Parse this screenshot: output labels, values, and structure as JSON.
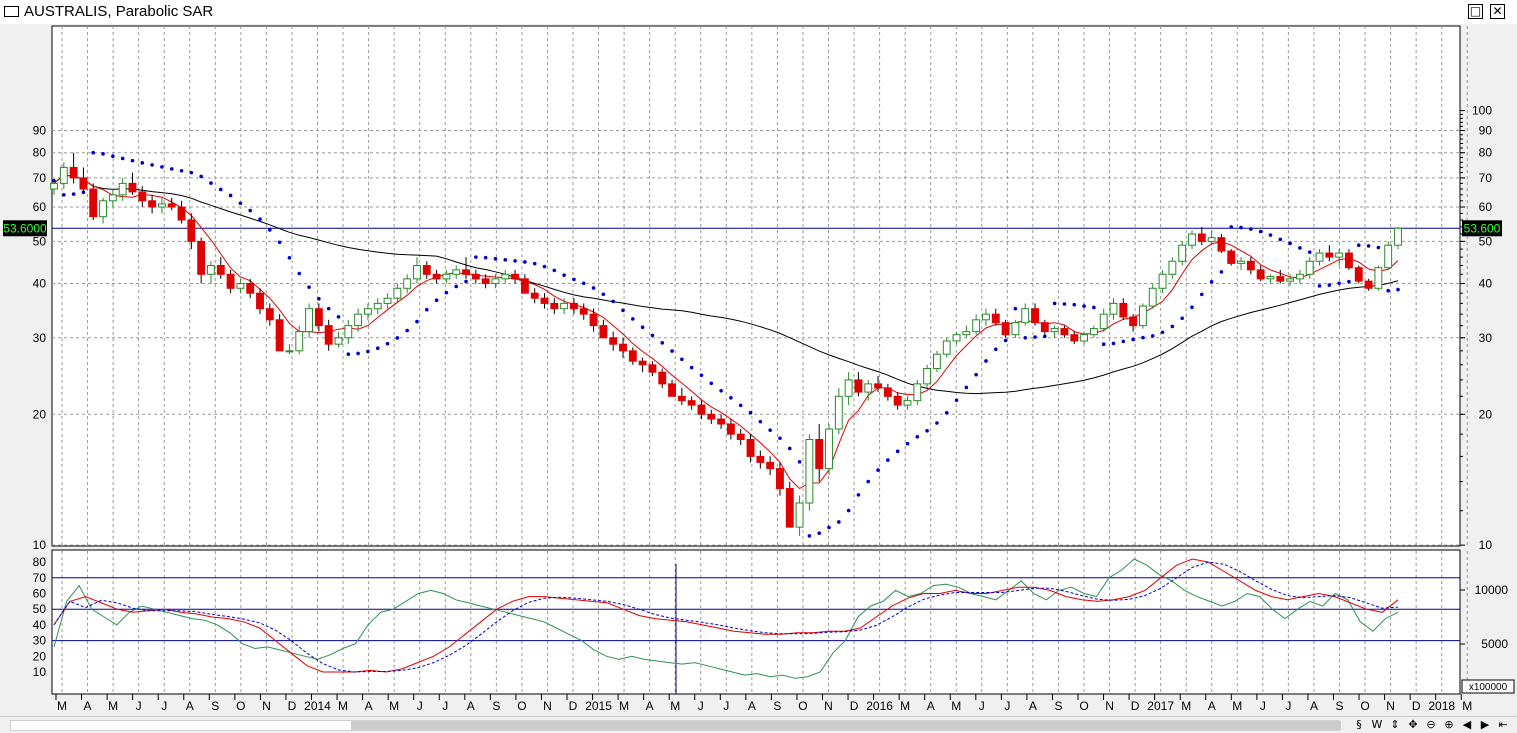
{
  "window": {
    "title": "AUSTRALIS, Parabolic SAR"
  },
  "colors": {
    "up": "#ffffff",
    "up_border": "#2a8a2a",
    "down": "#e00000",
    "sar": "#0000cc",
    "ma_fast": "#e00000",
    "ma_slow": "#000000",
    "osc": "#2f8f55",
    "level": "#00009a",
    "price_tag": "#000000",
    "price_tag_text": "#33ff33"
  },
  "chart_data": [
    {
      "type": "candlestick",
      "title": "AUSTRALIS, Parabolic SAR",
      "y_scale": "log",
      "left_ticks": [
        "10",
        "20",
        "30",
        "40",
        "50",
        "60",
        "70",
        "80",
        "90"
      ],
      "right_ticks": [
        "10",
        "20",
        "30",
        "40",
        "50",
        "60",
        "70",
        "80",
        "90",
        "100"
      ],
      "last_price": "53.6000",
      "last_price_right": "53.600",
      "x_labels": [
        "M",
        "A",
        "M",
        "J",
        "J",
        "A",
        "S",
        "O",
        "N",
        "D",
        "2014",
        "M",
        "A",
        "M",
        "J",
        "J",
        "A",
        "S",
        "O",
        "N",
        "D",
        "2015",
        "M",
        "A",
        "M",
        "J",
        "J",
        "A",
        "S",
        "O",
        "N",
        "D",
        "2016",
        "M",
        "A",
        "M",
        "J",
        "J",
        "A",
        "S",
        "O",
        "N",
        "D",
        "2017",
        "M",
        "A",
        "M",
        "J",
        "J",
        "A",
        "S",
        "O",
        "N",
        "D",
        "2018",
        "M"
      ],
      "series_ohlc_weekly": [
        [
          66,
          69,
          64,
          68
        ],
        [
          68,
          76,
          66,
          74
        ],
        [
          74,
          80,
          68,
          70
        ],
        [
          70,
          74,
          65,
          66
        ],
        [
          66,
          68,
          56,
          57
        ],
        [
          57,
          63,
          55,
          62
        ],
        [
          62,
          66,
          60,
          64
        ],
        [
          64,
          70,
          62,
          68
        ],
        [
          68,
          72,
          64,
          65
        ],
        [
          65,
          67,
          60,
          62
        ],
        [
          62,
          64,
          58,
          60
        ],
        [
          60,
          63,
          58,
          61
        ],
        [
          61,
          63,
          59,
          60
        ],
        [
          60,
          62,
          55,
          56
        ],
        [
          56,
          58,
          48,
          50
        ],
        [
          50,
          51,
          40,
          42
        ],
        [
          42,
          45,
          40,
          44
        ],
        [
          44,
          46,
          41,
          42
        ],
        [
          42,
          43,
          38,
          39
        ],
        [
          39,
          41,
          38,
          40
        ],
        [
          40,
          41,
          37,
          38
        ],
        [
          38,
          39,
          34,
          35
        ],
        [
          35,
          36,
          32,
          33
        ],
        [
          33,
          34,
          28,
          28
        ],
        [
          28,
          29,
          27.5,
          28
        ],
        [
          28,
          32,
          27.5,
          31
        ],
        [
          31,
          36,
          30,
          35
        ],
        [
          35,
          36,
          31,
          32
        ],
        [
          32,
          33,
          28,
          29
        ],
        [
          29,
          31,
          28.5,
          30
        ],
        [
          30,
          33,
          29,
          32
        ],
        [
          32,
          35,
          31,
          34
        ],
        [
          34,
          36,
          33,
          35
        ],
        [
          35,
          37,
          34,
          36
        ],
        [
          36,
          38,
          35,
          37
        ],
        [
          37,
          40,
          36,
          39
        ],
        [
          39,
          42,
          38,
          41
        ],
        [
          41,
          46,
          40,
          44
        ],
        [
          44,
          45,
          41,
          42
        ],
        [
          42,
          43,
          40,
          41
        ],
        [
          41,
          43,
          40,
          42
        ],
        [
          42,
          44,
          41,
          43
        ],
        [
          43,
          46,
          41,
          42
        ],
        [
          42,
          43,
          40,
          41
        ],
        [
          41,
          42,
          39,
          40
        ],
        [
          40,
          42,
          39,
          41
        ],
        [
          41,
          43,
          40,
          42
        ],
        [
          42,
          43,
          40,
          41
        ],
        [
          41,
          42,
          38,
          38
        ],
        [
          38,
          39,
          36,
          37
        ],
        [
          37,
          38,
          35,
          36
        ],
        [
          36,
          37,
          34,
          35
        ],
        [
          35,
          37,
          34,
          36
        ],
        [
          36,
          37,
          34,
          35
        ],
        [
          35,
          36,
          33,
          34
        ],
        [
          34,
          35,
          31,
          32
        ],
        [
          32,
          33,
          30,
          30
        ],
        [
          30,
          31,
          28,
          29
        ],
        [
          29,
          30,
          27,
          28
        ],
        [
          28,
          28.5,
          26,
          26.5
        ],
        [
          26.5,
          27,
          25,
          26
        ],
        [
          26,
          26.5,
          24.5,
          25
        ],
        [
          25,
          25.5,
          23,
          23.5
        ],
        [
          23.5,
          24,
          22,
          22
        ],
        [
          22,
          23,
          21,
          21.5
        ],
        [
          21.5,
          22,
          20.5,
          21
        ],
        [
          21,
          21.5,
          19.5,
          20
        ],
        [
          20,
          20.5,
          19,
          19.5
        ],
        [
          19.5,
          20,
          18.5,
          19
        ],
        [
          19,
          19.5,
          17.5,
          18
        ],
        [
          18,
          18.5,
          17,
          17.5
        ],
        [
          17.5,
          18,
          15.5,
          16
        ],
        [
          16,
          16.5,
          15,
          15.5
        ],
        [
          15.5,
          16,
          14.5,
          15
        ],
        [
          15,
          15.5,
          13,
          13.5
        ],
        [
          13.5,
          14,
          11,
          11
        ],
        [
          11,
          13,
          10.5,
          12.5
        ],
        [
          12.5,
          18,
          12,
          17.5
        ],
        [
          17.5,
          19,
          14,
          15
        ],
        [
          15,
          19,
          14.5,
          18.5
        ],
        [
          18.5,
          23,
          18,
          22
        ],
        [
          22,
          25,
          21,
          24
        ],
        [
          24,
          25,
          22,
          22.5
        ],
        [
          22.5,
          24,
          21.5,
          23.5
        ],
        [
          23.5,
          24.5,
          22.5,
          23
        ],
        [
          23,
          23.5,
          21.5,
          22
        ],
        [
          22,
          22.5,
          20.5,
          21
        ],
        [
          21,
          22,
          20.5,
          21.5
        ],
        [
          21.5,
          24,
          21,
          23.5
        ],
        [
          23.5,
          26,
          23,
          25.5
        ],
        [
          25.5,
          28,
          25,
          27.5
        ],
        [
          27.5,
          30,
          27,
          29.5
        ],
        [
          29.5,
          31,
          29,
          30.5
        ],
        [
          30.5,
          32,
          30,
          31
        ],
        [
          31,
          34,
          30.5,
          33
        ],
        [
          33,
          35,
          32,
          34
        ],
        [
          34,
          35,
          32,
          32.5
        ],
        [
          32.5,
          33,
          30,
          30.5
        ],
        [
          30.5,
          33,
          30,
          32.5
        ],
        [
          32.5,
          36,
          32,
          35
        ],
        [
          35,
          36,
          32,
          32.5
        ],
        [
          32.5,
          33,
          30.5,
          31
        ],
        [
          31,
          32,
          30,
          31.5
        ],
        [
          31.5,
          32,
          30,
          30.5
        ],
        [
          30.5,
          31,
          29,
          29.5
        ],
        [
          29.5,
          31,
          29,
          30.5
        ],
        [
          30.5,
          32,
          30,
          31.5
        ],
        [
          31.5,
          35,
          31,
          34
        ],
        [
          34,
          37,
          33,
          36
        ],
        [
          36,
          37,
          33,
          33.5
        ],
        [
          33.5,
          34,
          31,
          32
        ],
        [
          32,
          36,
          31.5,
          35.5
        ],
        [
          35.5,
          40,
          35,
          39
        ],
        [
          39,
          43,
          38,
          42
        ],
        [
          42,
          46,
          41,
          45
        ],
        [
          45,
          50,
          44,
          49
        ],
        [
          49,
          53,
          48,
          52
        ],
        [
          52,
          54,
          49,
          50
        ],
        [
          50,
          53,
          49,
          51
        ],
        [
          51,
          52,
          47,
          47.5
        ],
        [
          47.5,
          48,
          44,
          44.5
        ],
        [
          44.5,
          46,
          43,
          45
        ],
        [
          45,
          46,
          42,
          43
        ],
        [
          43,
          44,
          40.5,
          41
        ],
        [
          41,
          42,
          40,
          41.5
        ],
        [
          41.5,
          43,
          40,
          40.5
        ],
        [
          40.5,
          42,
          39.5,
          41
        ],
        [
          41,
          43,
          40,
          42
        ],
        [
          42,
          46,
          41,
          45
        ],
        [
          45,
          48,
          44,
          47
        ],
        [
          47,
          49,
          45,
          46
        ],
        [
          46,
          48,
          44,
          47
        ],
        [
          47,
          48,
          43,
          43.5
        ],
        [
          43.5,
          44,
          40,
          40.5
        ],
        [
          40.5,
          41,
          38.5,
          39
        ],
        [
          39,
          44,
          38.5,
          43.5
        ],
        [
          43.5,
          50,
          43,
          49
        ],
        [
          49,
          54,
          48,
          53.6
        ]
      ],
      "x_range_weeks": [
        0,
        267
      ]
    },
    {
      "type": "line",
      "series": [
        {
          "name": "",
          "values": [
            26,
            55,
            65,
            50,
            45,
            40,
            48,
            52,
            50,
            48,
            46,
            44,
            43,
            40,
            35,
            28,
            25,
            26,
            24,
            22,
            20,
            18,
            21,
            25,
            28,
            40,
            48,
            50,
            55,
            60,
            62,
            60,
            56,
            54,
            52,
            50,
            48,
            46,
            44,
            42,
            38,
            34,
            30,
            24,
            20,
            18,
            20,
            18,
            17,
            16,
            15,
            16,
            14,
            12,
            10,
            8,
            9,
            7,
            8,
            6,
            7,
            10,
            22,
            30,
            45,
            52,
            55,
            62,
            58,
            60,
            65,
            66,
            64,
            60,
            58,
            56,
            62,
            68,
            60,
            56,
            62,
            64,
            60,
            58,
            70,
            75,
            82,
            78,
            72,
            68,
            62,
            58,
            55,
            52,
            55,
            60,
            58,
            50,
            44,
            50,
            55,
            52,
            60,
            56,
            42,
            36,
            44,
            48
          ]
        },
        {
          "name": "",
          "values": [
            40,
            55,
            58,
            54,
            50,
            48,
            49,
            50,
            48,
            47,
            45,
            44,
            42,
            38,
            30,
            22,
            14,
            10,
            10,
            10,
            11,
            10,
            12,
            16,
            20,
            26,
            34,
            42,
            50,
            55,
            58,
            58,
            57,
            56,
            55,
            54,
            50,
            46,
            44,
            43,
            42,
            40,
            38,
            36,
            35,
            34,
            34,
            35,
            35,
            36,
            36,
            38,
            45,
            52,
            57,
            60,
            60,
            62,
            60,
            60,
            62,
            64,
            64,
            62,
            58,
            56,
            55,
            56,
            58,
            62,
            70,
            78,
            82,
            80,
            74,
            68,
            62,
            58,
            56,
            58,
            60,
            58,
            54,
            50,
            48,
            56
          ]
        }
      ]
    }
  ],
  "lower_panel": {
    "left_ticks": [
      "10",
      "20",
      "30",
      "40",
      "50",
      "60",
      "70",
      "80"
    ],
    "right_ticks": [
      "5000",
      "10000"
    ],
    "multiplier": "x100000"
  },
  "controls": {
    "items": [
      "§",
      "W",
      "⇕",
      "✥",
      "⊖",
      "⊕",
      "◀",
      "▶",
      "⇤"
    ]
  }
}
